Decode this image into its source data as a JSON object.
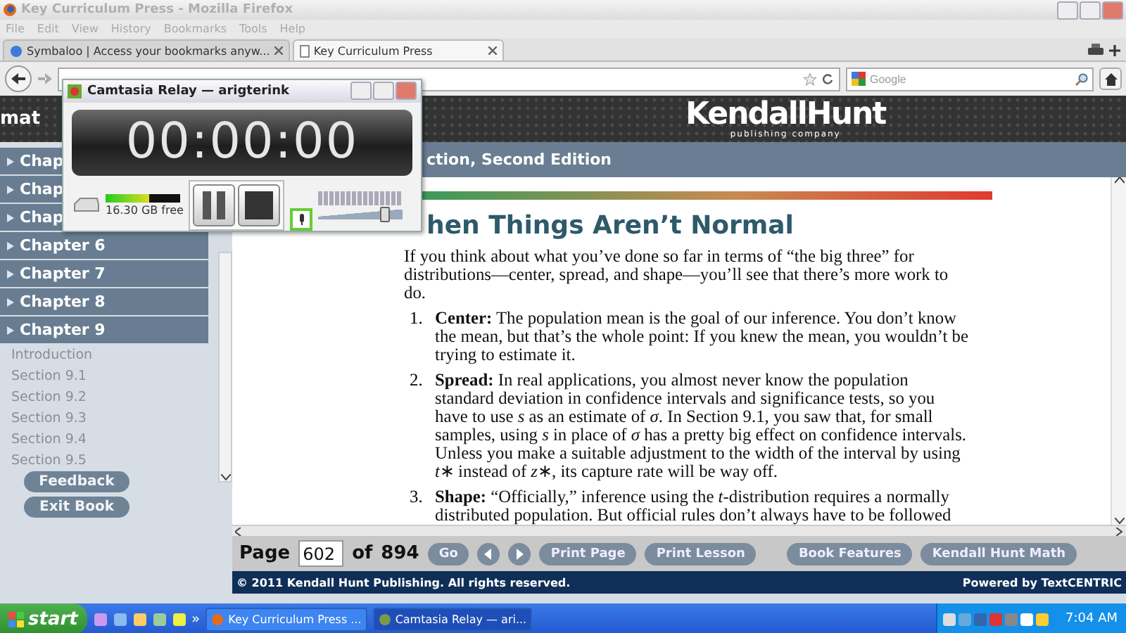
{
  "window": {
    "title": "Key Curriculum Press - Mozilla Firefox"
  },
  "menu": [
    "File",
    "Edit",
    "View",
    "History",
    "Bookmarks",
    "Tools",
    "Help"
  ],
  "tabs": [
    {
      "label": "Symbaloo | Access your bookmarks anyw...",
      "selected": false
    },
    {
      "label": "Key Curriculum Press",
      "selected": true
    }
  ],
  "search": {
    "placeholder": "Google"
  },
  "site_header": {
    "partial_title": "mat",
    "logo": "KendallHunt",
    "tagline": "publishing company"
  },
  "sidebar": {
    "chapters": [
      "Chap",
      "Chap",
      "Chap",
      "Chapter 6",
      "Chapter 7",
      "Chapter 8",
      "Chapter 9"
    ],
    "sections": [
      "Introduction",
      "Section 9.1",
      "Section 9.2",
      "Section 9.3",
      "Section 9.4",
      "Section 9.5"
    ],
    "buttons": [
      "Feedback",
      "Exit Book"
    ]
  },
  "book_title": "ction, Second Edition",
  "heading": "hen Things Aren’t Normal",
  "intro": "If you think about what you’ve done so far in terms of “the big three” for distributions—center, spread, and shape—you’ll see that there’s more work to do.",
  "list": [
    {
      "number": "1.",
      "text": "**Center:** The population mean is the goal of our inference. You don’t know the mean, but that’s the whole point: If you knew the mean, you wouldn’t be trying to estimate it."
    },
    {
      "number": "2.",
      "text": "**Spread:** In real applications, you almost never know the population standard deviation in confidence intervals and significance tests, so you have to use *s* as an estimate of *σ*. In Section 9.1, you saw that, for small samples, using *s* in place of *σ* has a pretty big effect on confidence intervals. Unless you make a suitable adjustment to the width of the interval by using *t*∗ instead of *z*∗, its capture rate will be way off."
    },
    {
      "number": "3.",
      "text": "**Shape:** “Officially,” inference using the *t*-distribution requires a normally distributed population. But official rules don’t always have to be followed"
    }
  ],
  "pager": {
    "label": "Page",
    "page": "602",
    "of": "of",
    "total": "894",
    "go": "Go",
    "buttons": [
      "Print Page",
      "Print Lesson"
    ],
    "right_buttons": [
      "Book Features",
      "Kendall Hunt Math"
    ]
  },
  "footer": {
    "copyright": "© 2011 Kendall Hunt Publishing. All rights reserved.",
    "powered": "Powered by TextCENTRIC"
  },
  "recorder": {
    "title": "Camtasia Relay — arigterink",
    "timer": "00:00:00",
    "disk": {
      "level": 0.58,
      "free": "16.30 GB free"
    },
    "volume": {
      "level": 0.78
    }
  },
  "taskbar": {
    "start": "start",
    "more": "»",
    "tasks": [
      {
        "label": "Key Curriculum Press ...",
        "selected": false
      },
      {
        "label": "Camtasia Relay — ari...",
        "selected": true
      }
    ],
    "clock": "7:04 AM"
  }
}
